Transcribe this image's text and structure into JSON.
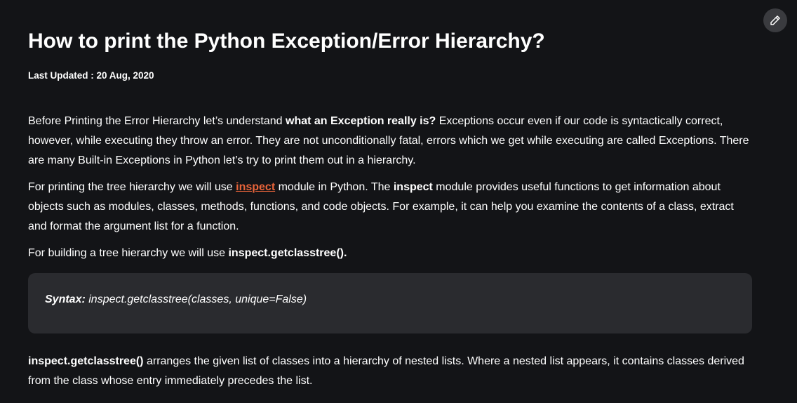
{
  "article": {
    "title": "How to print the Python Exception/Error Hierarchy?",
    "last_updated": "Last Updated : 20 Aug, 2020",
    "p1": {
      "t1": "Before Printing the Error Hierarchy let’s understand ",
      "b1": "what an Exception really is?",
      "t2": " Exceptions occur even if our code is syntactically correct, however, while executing they throw an error. They are not unconditionally fatal, errors which we get while executing are called Exceptions. There are many Built-in Exceptions in Python let’s try to print them out in a hierarchy."
    },
    "p2": {
      "t1": "For printing the tree hierarchy we will use ",
      "link": "inspect",
      "t2": " module in Python. The ",
      "b1": "inspect",
      "t3": " module provides useful functions to get information about objects such as modules, classes, methods, functions,  and code objects. For example, it can help you examine the contents of a class, extract and format the argument list for a function."
    },
    "p3": {
      "t1": "For building a tree hierarchy we will use ",
      "b1": "inspect.getclasstree()."
    },
    "syntax": {
      "label": "Syntax:",
      "code": " inspect.getclasstree(classes, unique=False)"
    },
    "p4": {
      "b1": "inspect.getclasstree()",
      "t1": " arranges the given list of classes into a hierarchy of nested lists. Where a nested list appears, it contains classes derived from the class whose entry immediately precedes the list."
    }
  },
  "icons": {
    "edit": "pencil-icon"
  }
}
